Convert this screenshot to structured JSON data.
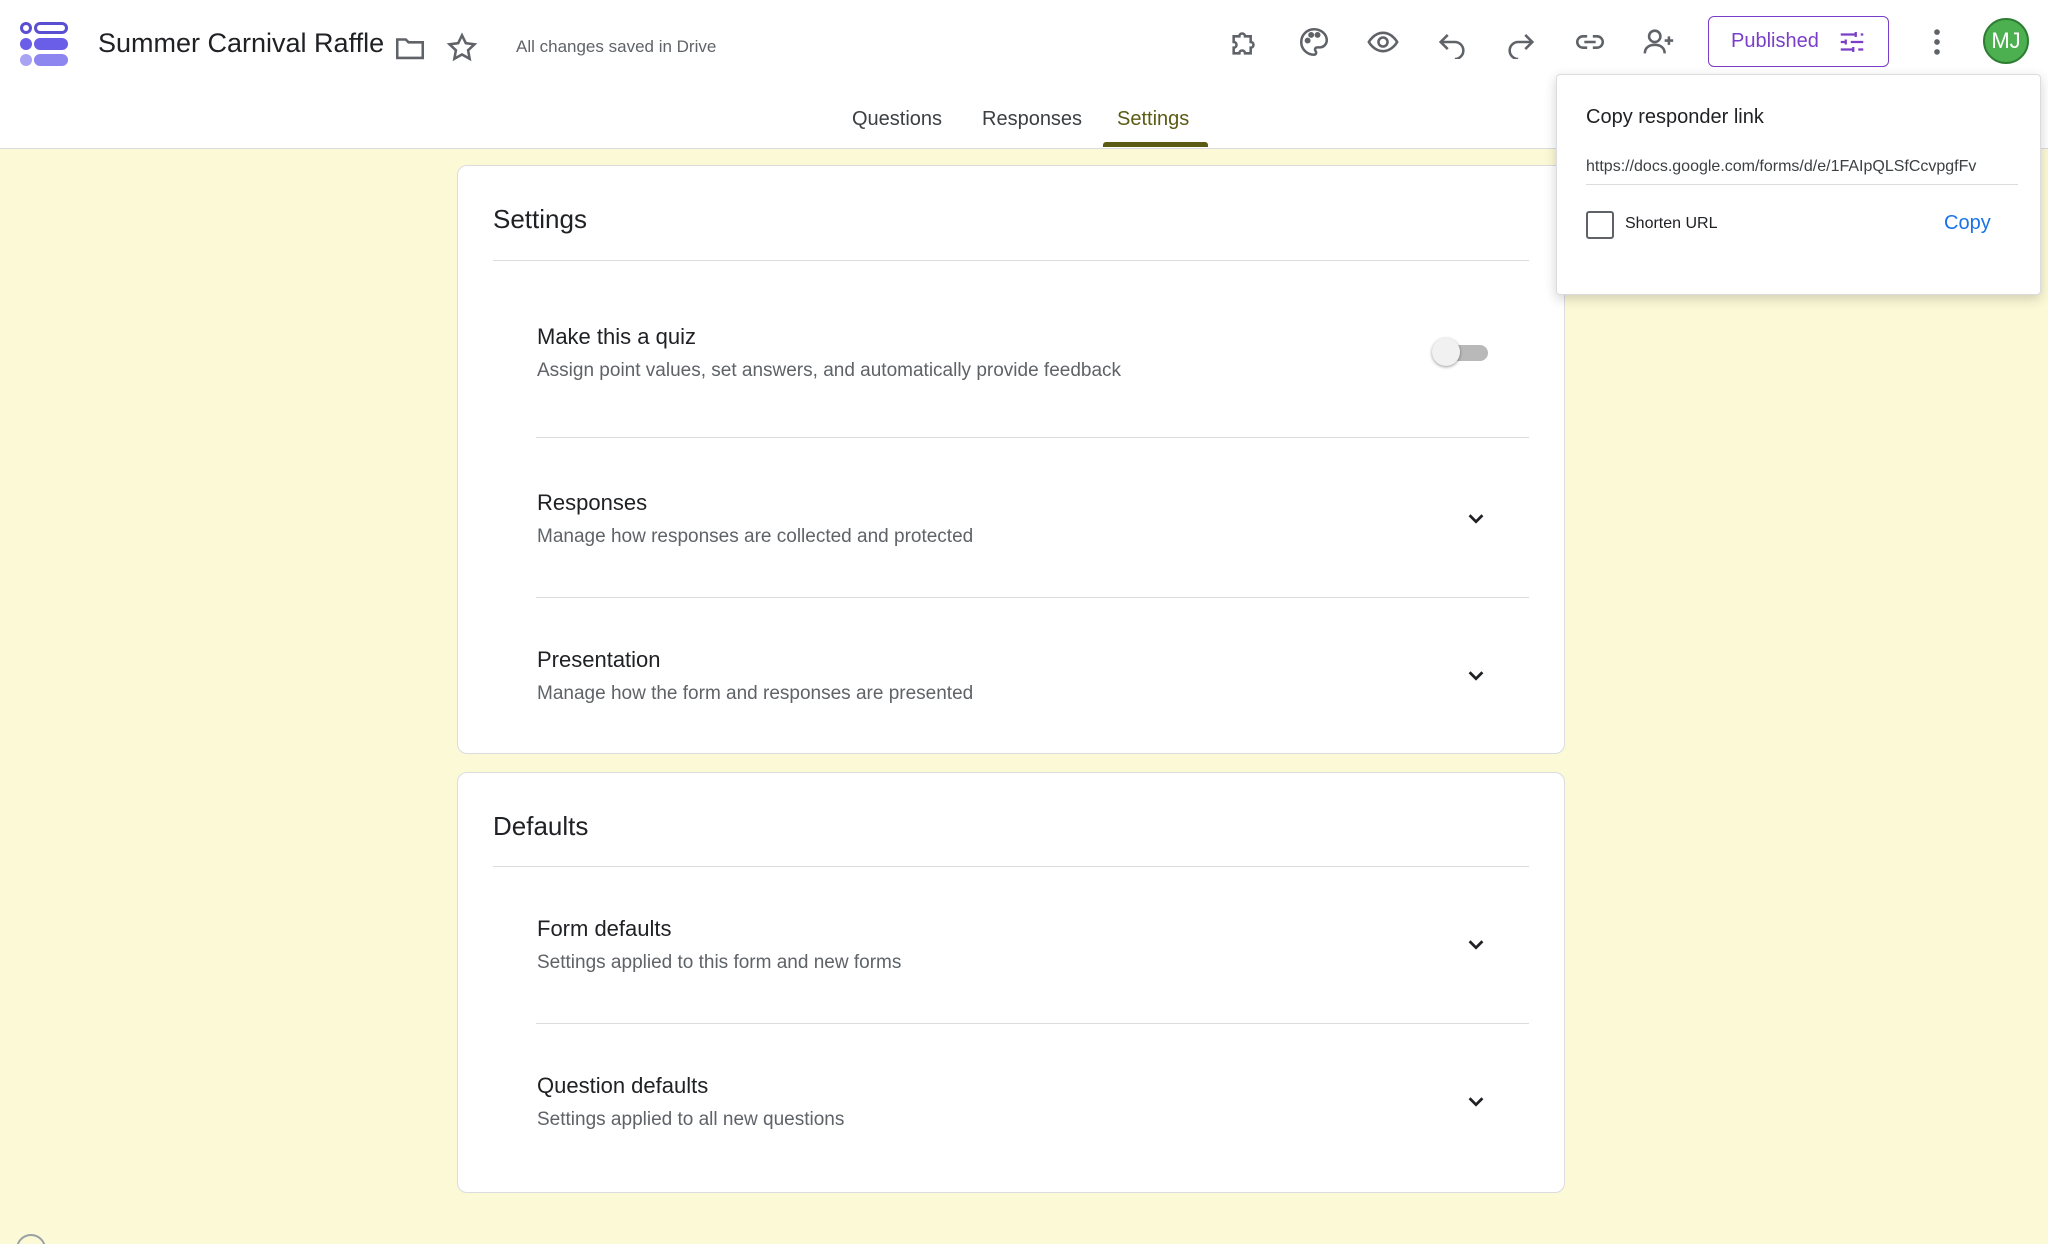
{
  "app": {
    "title": "Summer Carnival Raffle",
    "save_status": "All changes saved in Drive"
  },
  "header": {
    "icons": [
      "forms-logo-icon",
      "folder-icon",
      "star-icon",
      "addon-puzzle-icon",
      "palette-icon",
      "preview-eye-icon",
      "undo-icon",
      "redo-icon",
      "link-icon",
      "add-collaborator-icon",
      "more-vert-icon"
    ],
    "published_label": "Published",
    "avatar_initials": "MJ"
  },
  "tabs": [
    {
      "label": "Questions",
      "active": false
    },
    {
      "label": "Responses",
      "active": false
    },
    {
      "label": "Settings",
      "active": true
    }
  ],
  "settings_card": {
    "title": "Settings",
    "rows": [
      {
        "title": "Make this a quiz",
        "subtitle": "Assign point values, set answers, and automatically provide feedback",
        "control": "toggle",
        "toggle_on": false
      },
      {
        "title": "Responses",
        "subtitle": "Manage how responses are collected and protected",
        "control": "chevron-down-icon"
      },
      {
        "title": "Presentation",
        "subtitle": "Manage how the form and responses are presented",
        "control": "chevron-down-icon"
      }
    ]
  },
  "defaults_card": {
    "title": "Defaults",
    "rows": [
      {
        "title": "Form defaults",
        "subtitle": "Settings applied to this form and new forms",
        "control": "chevron-down-icon"
      },
      {
        "title": "Question defaults",
        "subtitle": "Settings applied to all new questions",
        "control": "chevron-down-icon"
      }
    ]
  },
  "popup": {
    "title": "Copy responder link",
    "url": "https://docs.google.com/forms/d/e/1FAIpQLSfCcvpgfFv",
    "shorten_label": "Shorten URL",
    "shorten_checked": false,
    "copy_label": "Copy"
  },
  "colors": {
    "background": "#fcfad6",
    "accent_tab": "#5b5b14",
    "published": "#7a3ec8",
    "link_blue": "#1a73e8",
    "avatar": "#4caf50"
  }
}
